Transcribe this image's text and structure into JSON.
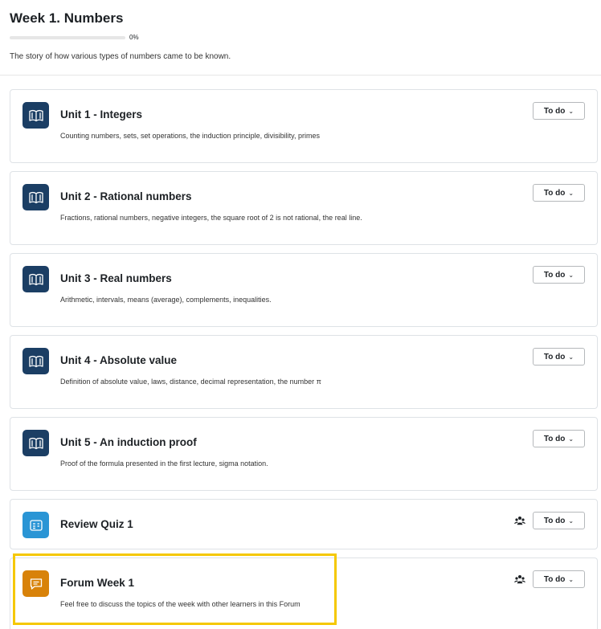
{
  "section": {
    "title": "Week 1. Numbers",
    "progress_percent": 0,
    "progress_label": "0%",
    "summary": "The story of how various types of numbers came to be known."
  },
  "activities": [
    {
      "type": "book",
      "icon": "book-icon",
      "title": "Unit 1 - Integers",
      "description": "Counting numbers, sets, set operations, the induction principle, divisibility, primes",
      "status": "To do"
    },
    {
      "type": "book",
      "icon": "book-icon",
      "title": "Unit 2 - Rational numbers",
      "description": "Fractions, rational numbers, negative integers, the square root of 2 is not rational, the real line.",
      "status": "To do"
    },
    {
      "type": "book",
      "icon": "book-icon",
      "title": "Unit 3 - Real numbers",
      "description": "Arithmetic, intervals, means (average), complements, inequalities.",
      "status": "To do"
    },
    {
      "type": "book",
      "icon": "book-icon",
      "title": "Unit 4 - Absolute value",
      "description": "Definition of absolute value, laws, distance, decimal representation, the number π",
      "status": "To do"
    },
    {
      "type": "book",
      "icon": "book-icon",
      "title": "Unit 5 - An induction proof",
      "description": "Proof of the formula presented in the first lecture, sigma notation.",
      "status": "To do"
    },
    {
      "type": "quiz",
      "icon": "quiz-icon",
      "title": "Review Quiz 1",
      "description": "",
      "status": "To do",
      "group_icon": "group-mode-icon"
    },
    {
      "type": "forum",
      "icon": "forum-icon",
      "title": "Forum Week 1",
      "description": "Feel free to discuss the topics of the week with other learners in this Forum",
      "status": "To do",
      "group_icon": "group-mode-icon"
    }
  ],
  "colors": {
    "book": "#1b3e64",
    "quiz": "#2a95d5",
    "forum": "#d88209",
    "highlight": "#f5c800",
    "progress_fill": "#0f6cbf"
  }
}
